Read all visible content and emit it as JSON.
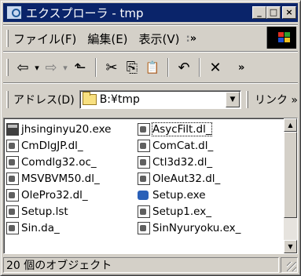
{
  "window": {
    "title": "エクスプローラ - tmp",
    "buttons": {
      "minimize": "_",
      "maximize": "□",
      "close": "×"
    }
  },
  "menu": {
    "items": [
      {
        "label": "ファイル(F)"
      },
      {
        "label": "編集(E)"
      },
      {
        "label": "表示(V)"
      }
    ],
    "overflow": "»"
  },
  "toolbar": {
    "back": "⇦",
    "forward": "⇨",
    "up": "⬑",
    "cut": "✂",
    "copy": "⎘",
    "paste": "📋",
    "undo": "↶",
    "delete": "✕",
    "overflow": "»",
    "dropdown": "▾"
  },
  "address": {
    "label": "アドレス(D)",
    "value": "B:¥tmp",
    "dropdown": "▼",
    "links": "リンク »"
  },
  "files": {
    "col1": [
      {
        "name": "jhsinginyu20.exe",
        "icon": "exe-icon"
      },
      {
        "name": "CmDlgJP.dl_",
        "icon": "file-icon"
      },
      {
        "name": "Comdlg32.oc_",
        "icon": "file-icon"
      },
      {
        "name": "MSVBVM50.dl_",
        "icon": "file-icon"
      },
      {
        "name": "OlePro32.dl_",
        "icon": "file-icon"
      },
      {
        "name": "Setup.lst",
        "icon": "file-icon"
      },
      {
        "name": "Sin.da_",
        "icon": "file-icon"
      }
    ],
    "col2": [
      {
        "name": "AsycFilt.dl_",
        "icon": "file-icon"
      },
      {
        "name": "ComCat.dl_",
        "icon": "file-icon"
      },
      {
        "name": "Ctl3d32.dl_",
        "icon": "file-icon"
      },
      {
        "name": "OleAut32.dl_",
        "icon": "file-icon"
      },
      {
        "name": "Setup.exe",
        "icon": "setup-icon"
      },
      {
        "name": "Setup1.ex_",
        "icon": "file-icon"
      },
      {
        "name": "SinNyuryoku.ex_",
        "icon": "file-icon"
      }
    ]
  },
  "scrollbar": {
    "up": "▲",
    "down": "▼"
  },
  "status": {
    "text": "20 個のオブジェクト"
  },
  "colors": {
    "titlebar": "#0a246a",
    "face": "#d4d0c8"
  }
}
